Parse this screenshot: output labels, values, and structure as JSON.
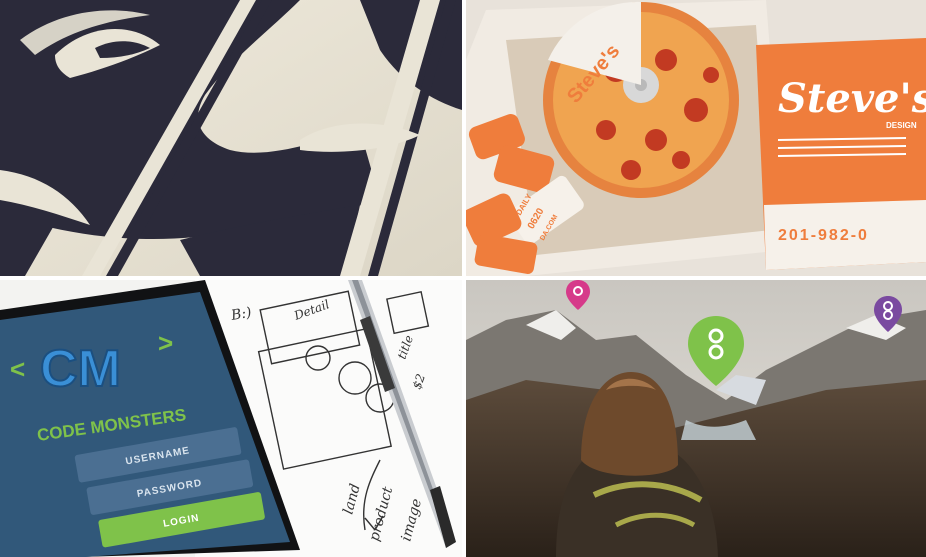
{
  "tiles": [
    {
      "id": "ninja-illustration"
    },
    {
      "id": "steves-pizza-branding"
    },
    {
      "id": "code-monsters-app"
    },
    {
      "id": "hiker-mountain-map"
    }
  ],
  "pizza": {
    "brand": "Steve's",
    "cd_brand": "Steve's",
    "design_word": "DESIGN",
    "phone": "201-982-0",
    "sticker_line1": "DAILY",
    "sticker_line2": "0620",
    "sticker_line3": "DA.COM"
  },
  "app": {
    "logo": "CM",
    "left_bracket": "<",
    "right_bracket": ">",
    "name": "CODE MONSTERS",
    "username_label": "USERNAME",
    "password_label": "PASSWORD",
    "login_label": "LOGIN"
  },
  "sketch": {
    "note1": "B:)",
    "note2": "Detail",
    "note3": "title",
    "note4": "$2",
    "note5": "land",
    "note6": "product",
    "note7": "image"
  },
  "colors": {
    "ninja_dark": "#2b2a3a",
    "paper": "#e9e4d6",
    "orange": "#ef7d3c",
    "phone_bg": "#31587a",
    "monster_blue": "#3a8fd6",
    "monster_green": "#7fc24a",
    "pin_green": "#7fc24a",
    "pin_pink": "#d63a8a",
    "pin_purple": "#7a4aa0"
  }
}
